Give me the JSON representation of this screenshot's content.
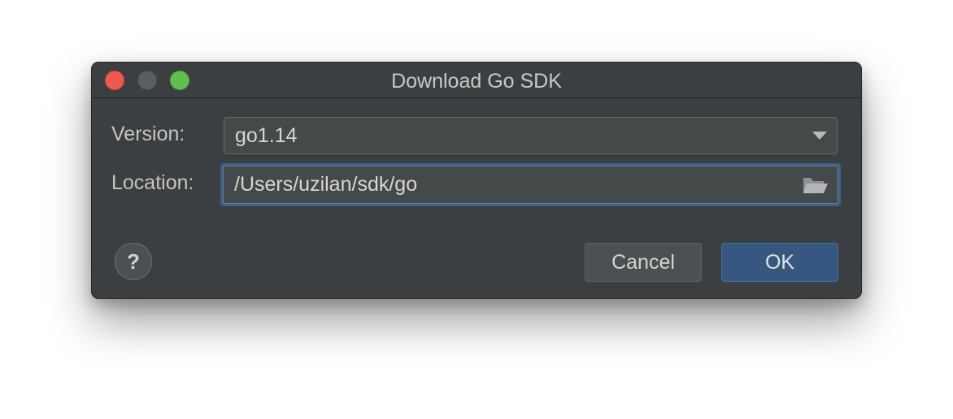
{
  "window": {
    "title": "Download Go SDK"
  },
  "form": {
    "version_label": "Version:",
    "version_value": "go1.14",
    "location_label": "Location:",
    "location_value": "/Users/uzilan/sdk/go"
  },
  "buttons": {
    "help_label": "?",
    "cancel_label": "Cancel",
    "ok_label": "OK"
  },
  "icons": {
    "dropdown": "chevron-down-icon",
    "browse": "folder-open-icon",
    "help": "help-icon"
  },
  "colors": {
    "dialog_bg": "#3c3f41",
    "focus_border": "#3d6185",
    "ok_button": "#365880",
    "close_light": "#ee5a52",
    "zoom_light": "#5fc04c",
    "minimize_light": "#5b5e61"
  }
}
